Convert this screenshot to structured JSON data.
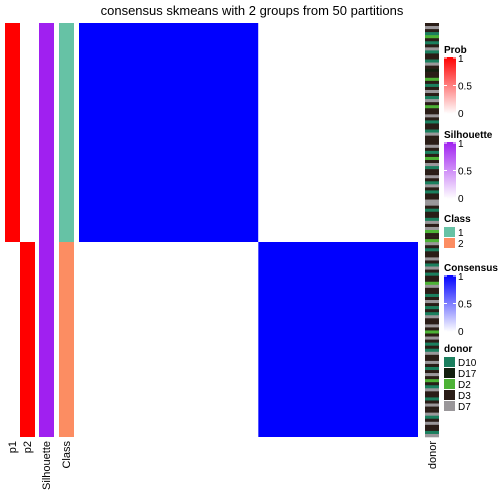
{
  "chart_data": {
    "type": "heatmap",
    "title": "consensus skmeans with 2 groups from 50 partitions",
    "n_samples": 138,
    "groups": [
      {
        "class": "1",
        "size": 73,
        "consensus": 1,
        "p1": 1,
        "p2": 0,
        "silhouette": 1
      },
      {
        "class": "2",
        "size": 65,
        "consensus": 1,
        "p1": 0,
        "p2": 1,
        "silhouette": 1
      }
    ],
    "annotation_columns": [
      "p1",
      "p2",
      "Silhouette",
      "Class"
    ],
    "right_annotation": "donor",
    "donor_sequence": "DEDACDADEADDAEDBDDCDADEDAEDCDDEDADDAEDDDEDADCDEADDEDAEDADDEEDADDAEDECDDCEDADDEDAEDADDCEDDADEDADAEDDEDCDEDADAEDDEDADEDCDAEDDADEDDEADEDDAE",
    "donor_codes": {
      "A": "D10",
      "B": "D17",
      "C": "D2",
      "D": "D3",
      "E": "D7"
    },
    "legends": [
      {
        "title": "Prob",
        "type": "continuous",
        "ticks": [
          "1",
          "0.5",
          "0"
        ],
        "color_high": "#FF0000",
        "color_low": "#FFFFFF"
      },
      {
        "title": "Silhouette",
        "type": "continuous",
        "ticks": [
          "1",
          "0.5",
          "0"
        ],
        "color_high": "#A020F0",
        "color_low": "#FFFFFF"
      },
      {
        "title": "Class",
        "type": "discrete",
        "entries": [
          {
            "label": "1",
            "color": "#66C2A5"
          },
          {
            "label": "2",
            "color": "#FC8D62"
          }
        ]
      },
      {
        "title": "Consensus",
        "type": "continuous",
        "ticks": [
          "1",
          "0.5",
          "0"
        ],
        "color_high": "#0000FF",
        "color_low": "#FFFFFF"
      },
      {
        "title": "donor",
        "type": "discrete",
        "entries": [
          {
            "label": "D10",
            "color": "#1B7F5E"
          },
          {
            "label": "D17",
            "color": "#13200F"
          },
          {
            "label": "D2",
            "color": "#4DB236"
          },
          {
            "label": "D3",
            "color": "#2A1D17"
          },
          {
            "label": "D7",
            "color": "#9A979A"
          }
        ]
      }
    ]
  },
  "colors": {
    "prob": "#FF0000",
    "silhouette": "#A020F0",
    "consensus": "#0000FF",
    "class1": "#66C2A5",
    "class2": "#FC8D62"
  }
}
